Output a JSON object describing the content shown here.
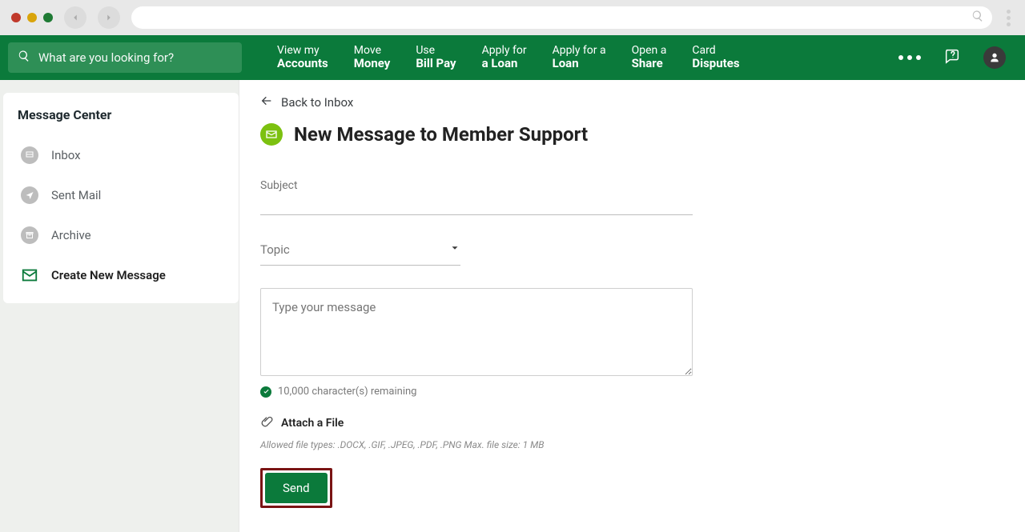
{
  "chrome": {
    "search_placeholder": ""
  },
  "search": {
    "placeholder": "What are you looking for?"
  },
  "nav": {
    "items": [
      {
        "l1": "View my",
        "l2": "Accounts"
      },
      {
        "l1": "Move",
        "l2": "Money"
      },
      {
        "l1": "Use",
        "l2": "Bill Pay"
      },
      {
        "l1": "Apply for",
        "l2": "a Loan"
      },
      {
        "l1": "Apply for a",
        "l2": "Loan"
      },
      {
        "l1": "Open a",
        "l2": "Share"
      },
      {
        "l1": "Card",
        "l2": "Disputes"
      }
    ]
  },
  "sidebar": {
    "title": "Message Center",
    "items": [
      {
        "label": "Inbox",
        "icon": "inbox-icon"
      },
      {
        "label": "Sent Mail",
        "icon": "sent-icon"
      },
      {
        "label": "Archive",
        "icon": "archive-icon"
      },
      {
        "label": "Create New Message",
        "icon": "compose-icon",
        "active": true
      }
    ]
  },
  "main": {
    "back_label": "Back to Inbox",
    "page_title": "New Message to Member Support",
    "subject_label": "Subject",
    "subject_value": "",
    "topic_label": "Topic",
    "message_placeholder": "Type your message",
    "remaining_text": "10,000 character(s) remaining",
    "attach_label": "Attach a File",
    "allowed_hint": "Allowed file types: .DOCX, .GIF, .JPEG, .PDF, .PNG  Max. file size: 1 MB",
    "send_label": "Send"
  },
  "colors": {
    "brand_green": "#0b7a3b",
    "lime": "#7cc110",
    "highlight_box": "#7a1414"
  }
}
